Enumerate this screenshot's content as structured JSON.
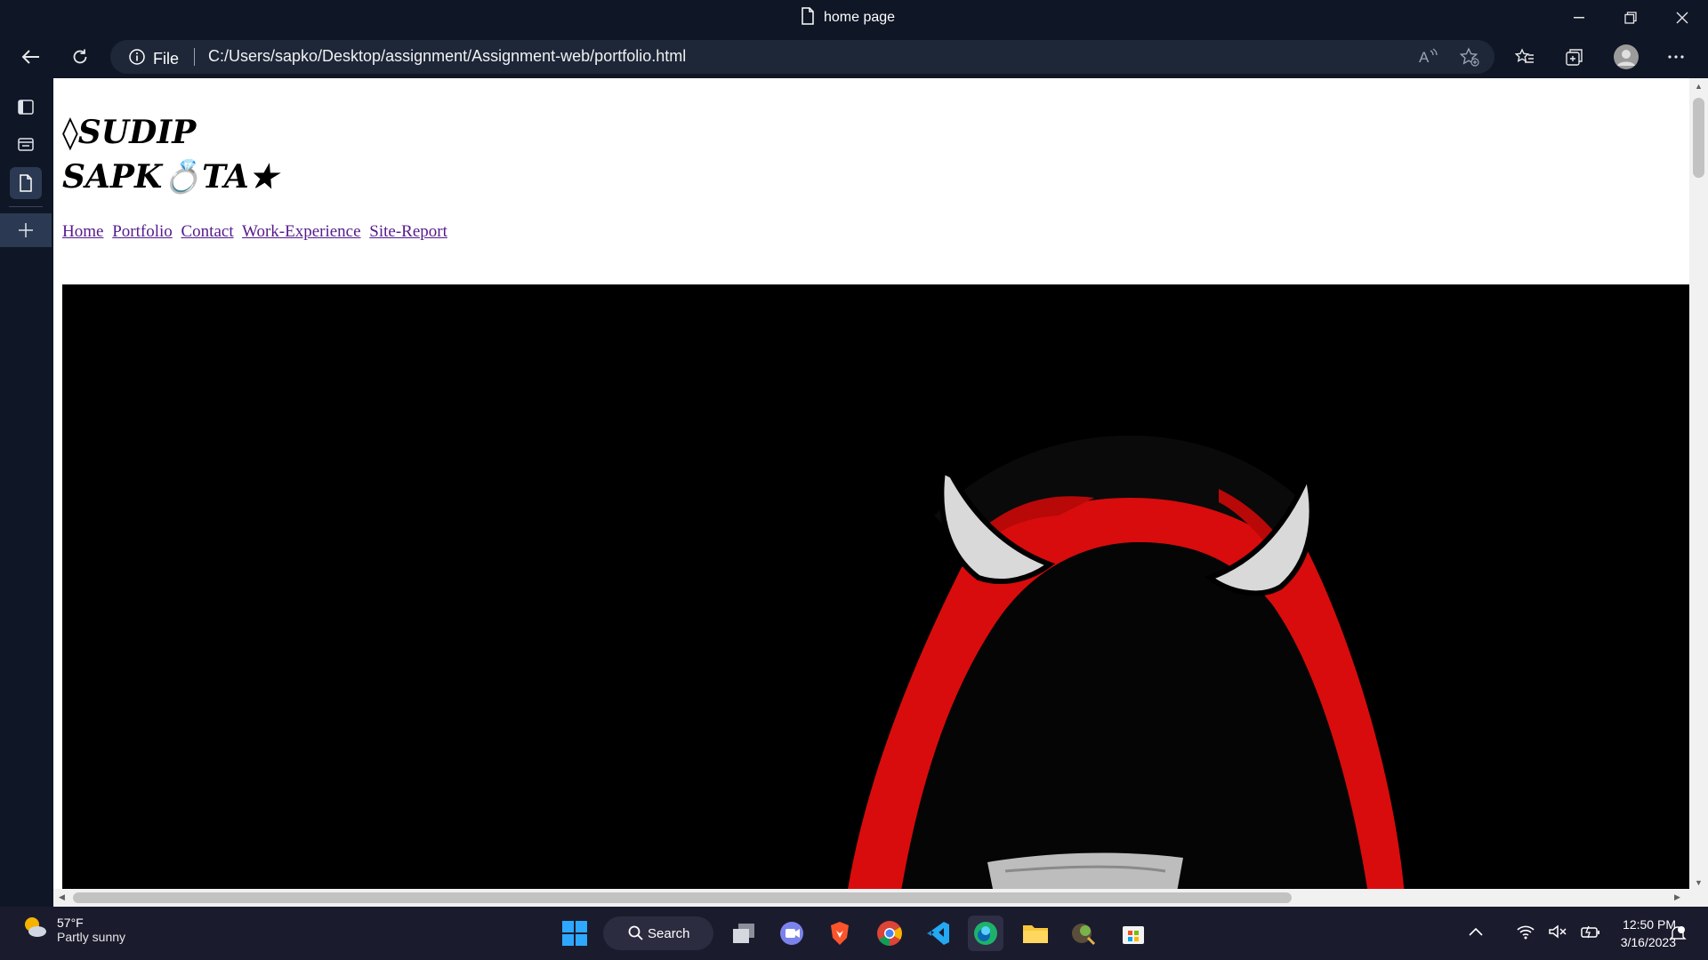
{
  "window": {
    "tab_title": "home page"
  },
  "address": {
    "protocol_label": "File",
    "url": "C:/Users/sapko/Desktop/assignment/Assignment-web/portfolio.html"
  },
  "page": {
    "title_line1": "◊SUDIP",
    "title_line2": "SAPK💍TA★",
    "nav": [
      "Home",
      "Portfolio",
      "Contact",
      "Work-Experience",
      "Site-Report"
    ],
    "link_color": "#551a8b"
  },
  "taskbar": {
    "weather_temp": "57°F",
    "weather_desc": "Partly sunny",
    "search_label": "Search",
    "time": "12:50 PM",
    "date": "3/16/2023"
  },
  "colors": {
    "chrome_bg": "#0f1626",
    "address_bg": "#1e2738",
    "taskbar_bg": "#1b1b2e",
    "hero_bg": "#000000",
    "hood_red": "#e01010"
  }
}
